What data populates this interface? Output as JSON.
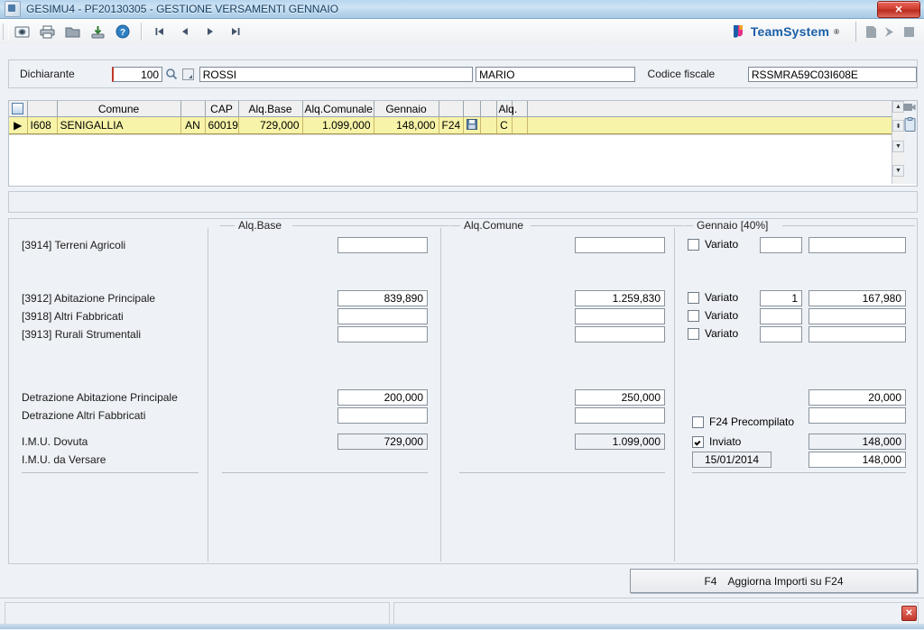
{
  "window": {
    "title": "GESIMU4  - PF20130305 -  GESTIONE VERSAMENTI GENNAIO",
    "app_icon": "app-icon",
    "close_label": "✕"
  },
  "toolbar": {
    "buttons": [
      {
        "name": "preview-icon",
        "glyph": "preview"
      },
      {
        "name": "print-icon",
        "glyph": "print"
      },
      {
        "name": "folder-icon",
        "glyph": "folder"
      },
      {
        "name": "export-icon",
        "glyph": "export"
      },
      {
        "name": "help-icon",
        "glyph": "help"
      }
    ],
    "nav": [
      {
        "name": "first-record-icon",
        "glyph": "⏮"
      },
      {
        "name": "prev-record-icon",
        "glyph": "◀"
      },
      {
        "name": "next-record-icon",
        "glyph": "▶"
      },
      {
        "name": "last-record-icon",
        "glyph": "⏭"
      }
    ],
    "brand": {
      "word": "TeamSystem",
      "reg": "®"
    },
    "right_icons": [
      {
        "name": "document-icon"
      },
      {
        "name": "forward-arrow-icon"
      },
      {
        "name": "window-icon"
      }
    ]
  },
  "header": {
    "dichiarante_label": "Dichiarante",
    "dichiarante_code": "100",
    "search_icon": "search-icon",
    "lookup_icon": "lookup-icon",
    "surname": "ROSSI",
    "firstname": "MARIO",
    "codice_fiscale_label": "Codice fiscale",
    "codice_fiscale": "RSSMRA59C03I608E"
  },
  "grid": {
    "columns": [
      "",
      "",
      "Comune",
      "",
      "CAP",
      "Alq.Base",
      "Alq.Comunale",
      "Gennaio",
      "",
      "",
      "",
      "Alq.",
      "",
      ""
    ],
    "rows": [
      {
        "marker": "▶",
        "codice": "I608",
        "comune": "SENIGALLIA",
        "prov": "AN",
        "cap": "60019",
        "alq_base": "729,000",
        "alq_comunale": "1.099,000",
        "gennaio": "148,000",
        "f24": "F24",
        "save_icon": "save-icon",
        "blank1": "",
        "alq": "C",
        "blank2": "",
        "blank3": ""
      }
    ],
    "scroll": {
      "up": "▲",
      "page_up": "⬍",
      "page_down": "▼",
      "down": "▼"
    },
    "side_icons": [
      {
        "name": "camera-icon"
      },
      {
        "name": "clipboard-icon"
      }
    ]
  },
  "detail": {
    "group_alq_base": "Alq.Base",
    "group_alq_comune": "Alq.Comune",
    "group_gennaio": "Gennaio [40%]",
    "rows": [
      {
        "label": "[3914] Terreni Agricoli",
        "alq_base": "",
        "alq_comune": "",
        "variato_label": "Variato",
        "variato_checked": false,
        "gen_small": "",
        "gen_value": ""
      },
      {
        "label": "[3912] Abitazione Principale",
        "alq_base": "839,890",
        "alq_comune": "1.259,830",
        "variato_label": "Variato",
        "variato_checked": false,
        "gen_small": "1",
        "gen_value": "167,980"
      },
      {
        "label": "[3918] Altri Fabbricati",
        "alq_base": "",
        "alq_comune": "",
        "variato_label": "Variato",
        "variato_checked": false,
        "gen_small": "",
        "gen_value": ""
      },
      {
        "label": "[3913] Rurali Strumentali",
        "alq_base": "",
        "alq_comune": "",
        "variato_label": "Variato",
        "variato_checked": false,
        "gen_small": "",
        "gen_value": ""
      }
    ],
    "detrazione_ap": {
      "label": "Detrazione Abitazione Principale",
      "alq_base": "200,000",
      "alq_comune": "250,000",
      "gennaio": "20,000"
    },
    "detrazione_af": {
      "label": "Detrazione Altri Fabbricati",
      "alq_base": "",
      "alq_comune": "",
      "gennaio": ""
    },
    "imu_dovuta": {
      "label": "I.M.U. Dovuta",
      "alq_base": "729,000",
      "alq_comune": "1.099,000",
      "gennaio": "148,000"
    },
    "imu_versare": {
      "label": "I.M.U. da Versare",
      "alq_base": "",
      "alq_comune": "",
      "gennaio": "148,000"
    },
    "f24_precompilato": {
      "label": "F24 Precompilato",
      "checked": false
    },
    "inviato": {
      "label": "Inviato",
      "checked": true
    },
    "inviato_date": "15/01/2014"
  },
  "actions": {
    "f4_key": "F4",
    "f4_label": "Aggiorna Importi su F24"
  },
  "statusbar": {
    "left_text": "",
    "right_text": "",
    "close_label": "✕"
  },
  "colors": {
    "accent": "#1b5fa8",
    "row_highlight": "#f7f3a8",
    "close_red": "#c43a2c",
    "window_blue": "#bcd8ee"
  }
}
